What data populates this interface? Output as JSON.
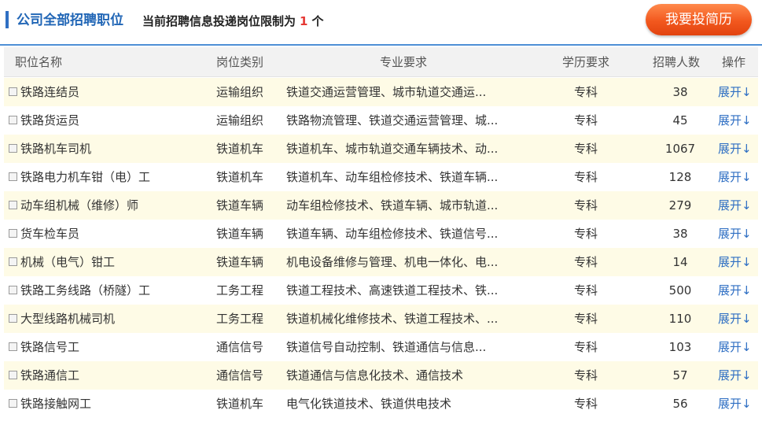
{
  "header": {
    "title": "公司全部招聘职位",
    "note_prefix": "当前招聘信息投递岗位限制为",
    "note_count": "1",
    "note_suffix": "个",
    "apply_button": "我要投简历"
  },
  "table": {
    "columns": [
      "职位名称",
      "岗位类别",
      "专业要求",
      "学历要求",
      "招聘人数",
      "操作"
    ],
    "rows": [
      {
        "name": "铁路连结员",
        "type": "运输组织",
        "major": "铁道交通运营管理、城市轨道交通运...",
        "edu": "专科",
        "count": "38",
        "op": "展开↓"
      },
      {
        "name": "铁路货运员",
        "type": "运输组织",
        "major": "铁路物流管理、铁道交通运营管理、城...",
        "edu": "专科",
        "count": "45",
        "op": "展开↓"
      },
      {
        "name": "铁路机车司机",
        "type": "铁道机车",
        "major": "铁道机车、城市轨道交通车辆技术、动...",
        "edu": "专科",
        "count": "1067",
        "op": "展开↓"
      },
      {
        "name": "铁路电力机车钳（电）工",
        "type": "铁道机车",
        "major": "铁道机车、动车组检修技术、铁道车辆...",
        "edu": "专科",
        "count": "128",
        "op": "展开↓"
      },
      {
        "name": "动车组机械（维修）师",
        "type": "铁道车辆",
        "major": "动车组检修技术、铁道车辆、城市轨道...",
        "edu": "专科",
        "count": "279",
        "op": "展开↓"
      },
      {
        "name": "货车检车员",
        "type": "铁道车辆",
        "major": "铁道车辆、动车组检修技术、铁道信号...",
        "edu": "专科",
        "count": "38",
        "op": "展开↓"
      },
      {
        "name": "机械（电气）钳工",
        "type": "铁道车辆",
        "major": "机电设备维修与管理、机电一体化、电...",
        "edu": "专科",
        "count": "14",
        "op": "展开↓"
      },
      {
        "name": "铁路工务线路（桥隧）工",
        "type": "工务工程",
        "major": "铁道工程技术、高速铁道工程技术、铁...",
        "edu": "专科",
        "count": "500",
        "op": "展开↓"
      },
      {
        "name": "大型线路机械司机",
        "type": "工务工程",
        "major": "铁道机械化维修技术、铁道工程技术、...",
        "edu": "专科",
        "count": "110",
        "op": "展开↓"
      },
      {
        "name": "铁路信号工",
        "type": "通信信号",
        "major": "铁道信号自动控制、铁道通信与信息...",
        "edu": "专科",
        "count": "103",
        "op": "展开↓"
      },
      {
        "name": "铁路通信工",
        "type": "通信信号",
        "major": "铁道通信与信息化技术、通信技术",
        "edu": "专科",
        "count": "57",
        "op": "展开↓"
      },
      {
        "name": "铁路接触网工",
        "type": "铁道机车",
        "major": "电气化铁道技术、铁道供电技术",
        "edu": "专科",
        "count": "56",
        "op": "展开↓"
      }
    ]
  }
}
